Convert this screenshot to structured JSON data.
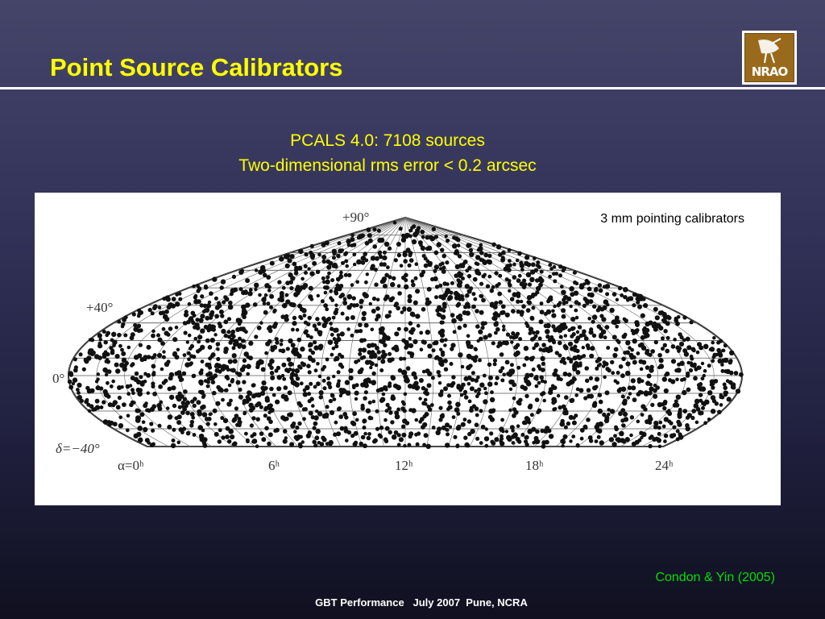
{
  "slide": {
    "title": "Point Source Calibrators",
    "subtitle_line1": "PCALS 4.0: 7108 sources",
    "subtitle_line2": "Two-dimensional rms error < 0.2 arcsec",
    "figure_label": "3 mm pointing calibrators",
    "citation": "Condon & Yin (2005)",
    "footer": "GBT Performance   July 2007  Pune, NCRA"
  },
  "logo": {
    "text": "NRAO",
    "icon": "nrao-dish-icon"
  },
  "sky_map": {
    "projection": "sinusoidal",
    "dec_range": [
      -40,
      90
    ],
    "ra_range_hours": [
      0,
      24
    ],
    "dec_labels": [
      "+90°",
      "+40°",
      "0°",
      "δ=−40°"
    ],
    "ra_labels": [
      "α=0ʰ",
      "6ʰ",
      "12ʰ",
      "18ʰ",
      "24ʰ"
    ],
    "grid": true,
    "source_marker": "black-dot"
  },
  "colors": {
    "title": "#ffff00",
    "subtitle": "#ffff00",
    "citation": "#00e000",
    "footer": "#ffffff"
  }
}
